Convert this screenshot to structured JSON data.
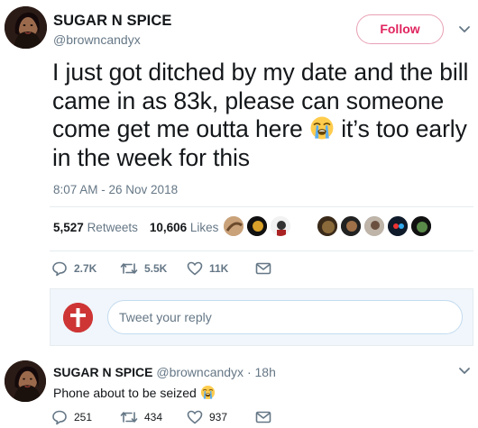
{
  "tweet": {
    "display_name": "SUGAR N SPICE",
    "handle": "@browncandyx",
    "follow_label": "Follow",
    "text_before_emoji": "I just got ditched by my date and the bill came in as 83k, please can someone come get me outta here ",
    "text_after_emoji": " it’s too early in the week for this",
    "emoji": "loudly-crying-face",
    "timestamp": "8:07 AM - 26 Nov 2018",
    "retweets_count": "5,527",
    "retweets_label": "Retweets",
    "likes_count": "10,606",
    "likes_label": "Likes",
    "actions": {
      "replies": "2.7K",
      "retweets": "5.5K",
      "likes": "11K"
    }
  },
  "reply_box": {
    "placeholder": "Tweet your reply"
  },
  "reply": {
    "display_name": "SUGAR N SPICE",
    "handle": "@browncandyx",
    "separator": " · ",
    "age": "18h",
    "text": "Phone about to be seized ",
    "emoji": "loudly-crying-face",
    "actions": {
      "replies": "251",
      "retweets": "434",
      "likes": "937"
    }
  },
  "colors": {
    "accent_pink": "#e0245e",
    "muted": "#657786",
    "text": "#14171a",
    "reply_box_bg": "#f0f6fb"
  }
}
